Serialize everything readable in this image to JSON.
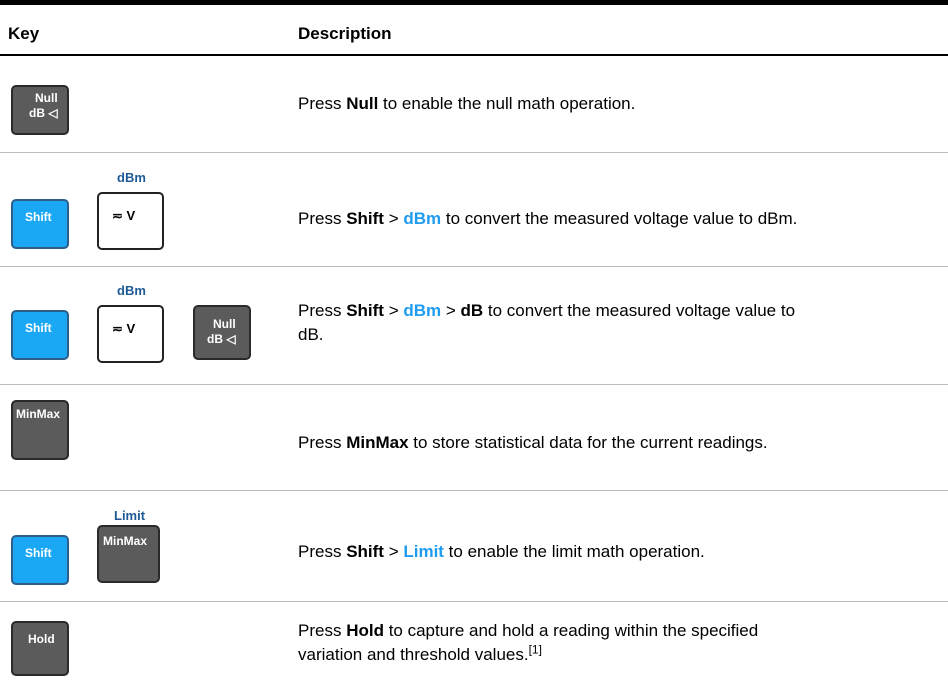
{
  "header": {
    "key": "Key",
    "description": "Description"
  },
  "keys": {
    "null_top": "Null",
    "null_bottom": "dB ◁",
    "shift": "Shift",
    "acv": "≂ V",
    "dbm_label": "dBm",
    "minmax": "MinMax",
    "limit_label": "Limit",
    "hold": "Hold"
  },
  "rows": [
    {
      "pre": "Press ",
      "b1": "Null",
      "post": " to enable the null math operation."
    },
    {
      "pre": "Press ",
      "b1": "Shift",
      "sep1": " > ",
      "blue1": "dBm",
      "post": " to convert the measured voltage value to dBm."
    },
    {
      "pre": "Press ",
      "b1": "Shift",
      "sep1": " > ",
      "blue1": "dBm",
      "sep2": " > ",
      "b2": "dB",
      "post": " to convert the measured voltage value to",
      "line2": "dB."
    },
    {
      "pre": "Press ",
      "b1": "MinMax",
      "post": " to store statistical data for the current readings."
    },
    {
      "pre": "Press ",
      "b1": "Shift",
      "sep1": " > ",
      "blue1": "Limit",
      "post": " to enable the limit math operation."
    },
    {
      "pre": "Press ",
      "b1": "Hold",
      "post": " to capture and hold a reading within the specified",
      "line2": "variation and threshold values.",
      "footnote": "[1]"
    }
  ]
}
